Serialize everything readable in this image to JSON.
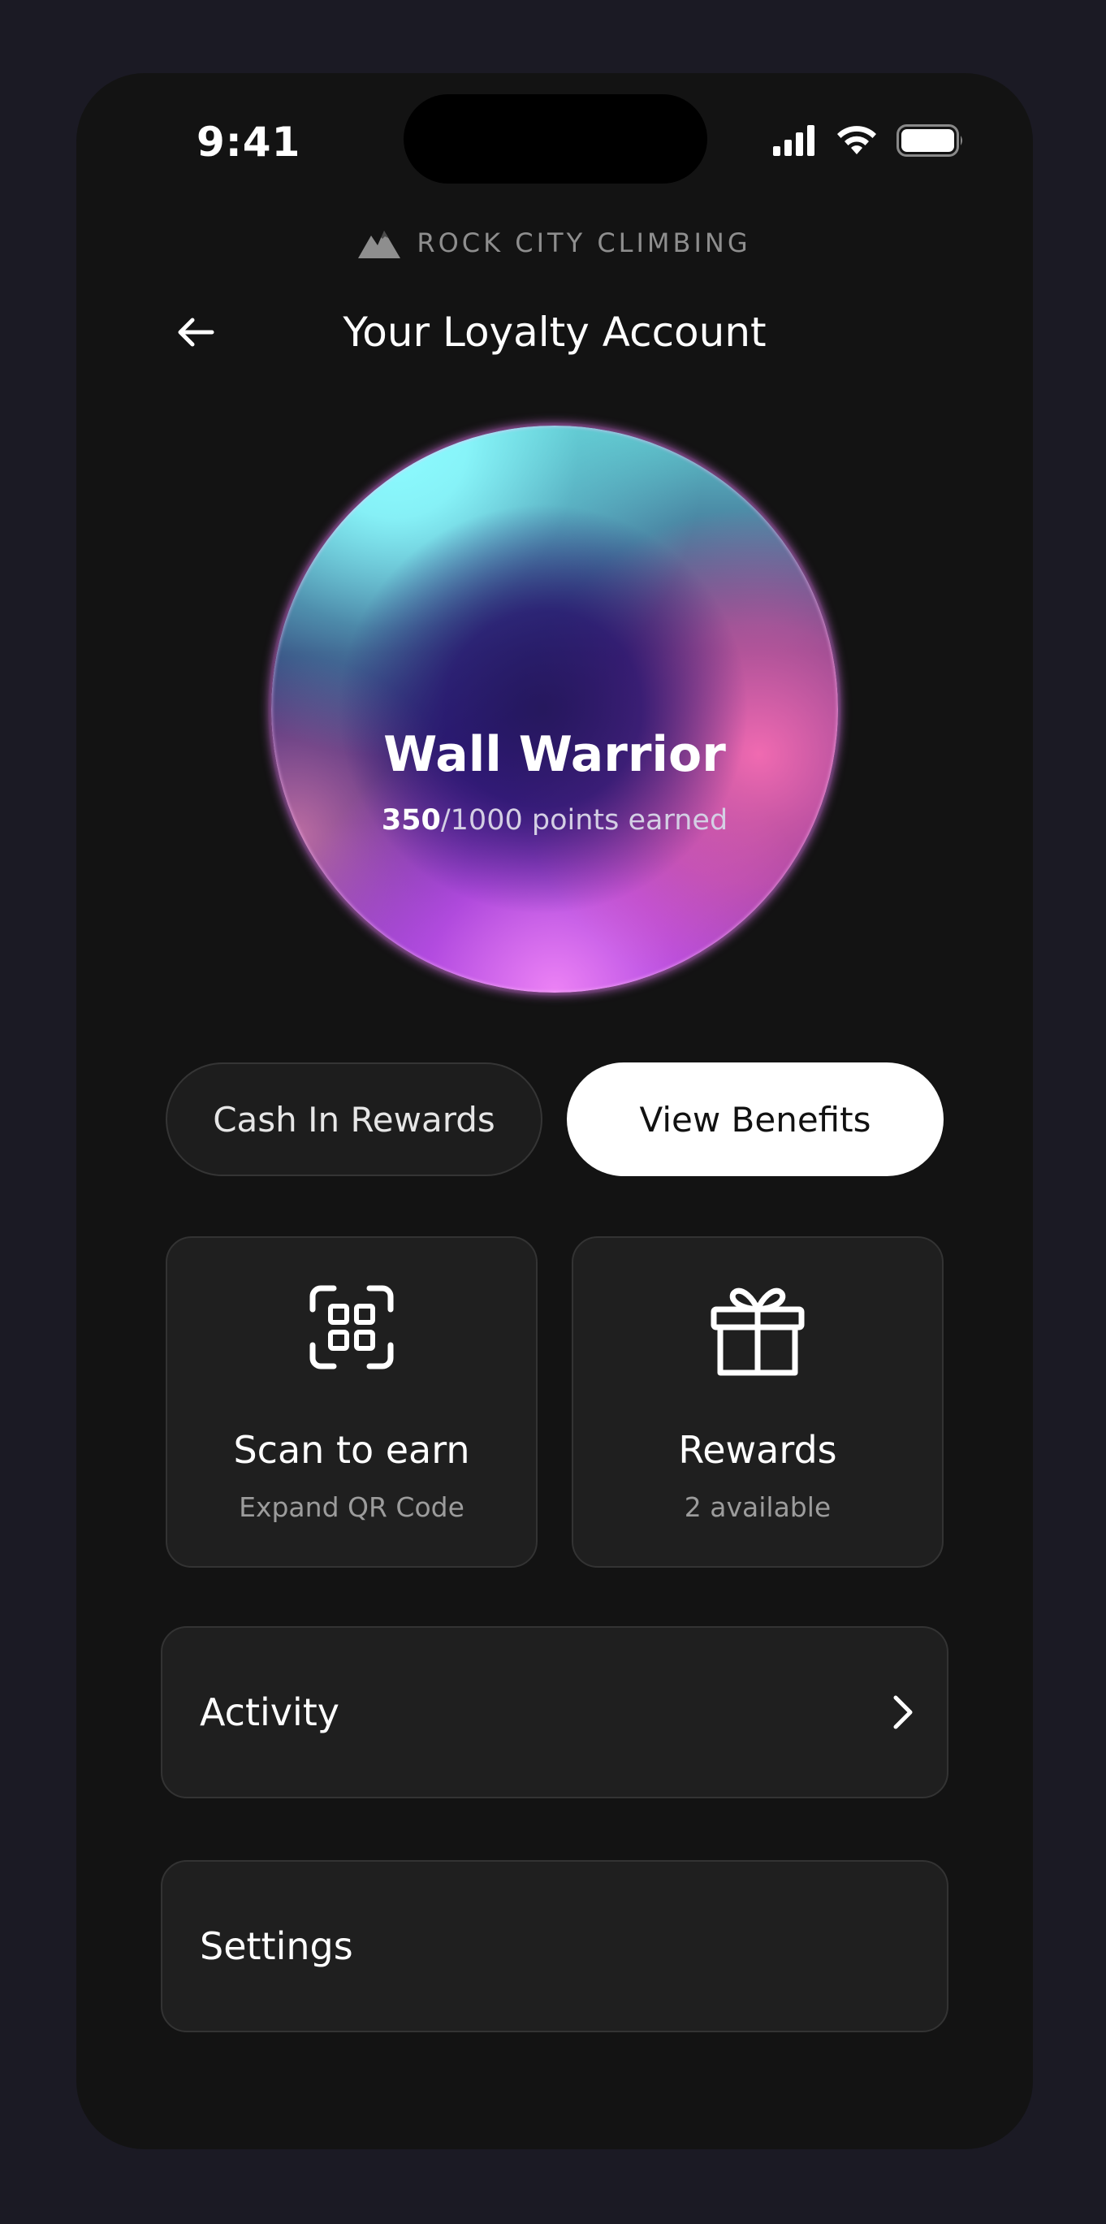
{
  "status_bar": {
    "time": "9:41",
    "icons": [
      "cellular-signal-icon",
      "wifi-icon",
      "battery-icon"
    ]
  },
  "brand": {
    "name": "ROCK CITY CLIMBING",
    "logo_icon": "mountain-icon"
  },
  "header": {
    "back_icon": "arrow-left-icon",
    "title": "Your Loyalty Account"
  },
  "tier": {
    "name": "Wall Warrior",
    "points_current": "350",
    "points_suffix": "/1000 points earned",
    "progress_fraction": 0.35
  },
  "actions": {
    "cash_in_label": "Cash In Rewards",
    "view_benefits_label": "View Benefits"
  },
  "cards": [
    {
      "icon": "qr-scan-icon",
      "title": "Scan to earn",
      "subtitle": "Expand QR Code"
    },
    {
      "icon": "gift-icon",
      "title": "Rewards",
      "subtitle": "2 available"
    }
  ],
  "menu": [
    {
      "label": "Activity",
      "icon": "chevron-right-icon"
    },
    {
      "label": "Settings"
    }
  ],
  "colors": {
    "background": "#131313",
    "frame": "#1b1a24",
    "card": "#1f1f1f",
    "primary_button": "#ffffff",
    "orb_cyan": "#8cfbff",
    "orb_pink": "#f06eb4",
    "orb_purple": "#3a1a7e"
  }
}
